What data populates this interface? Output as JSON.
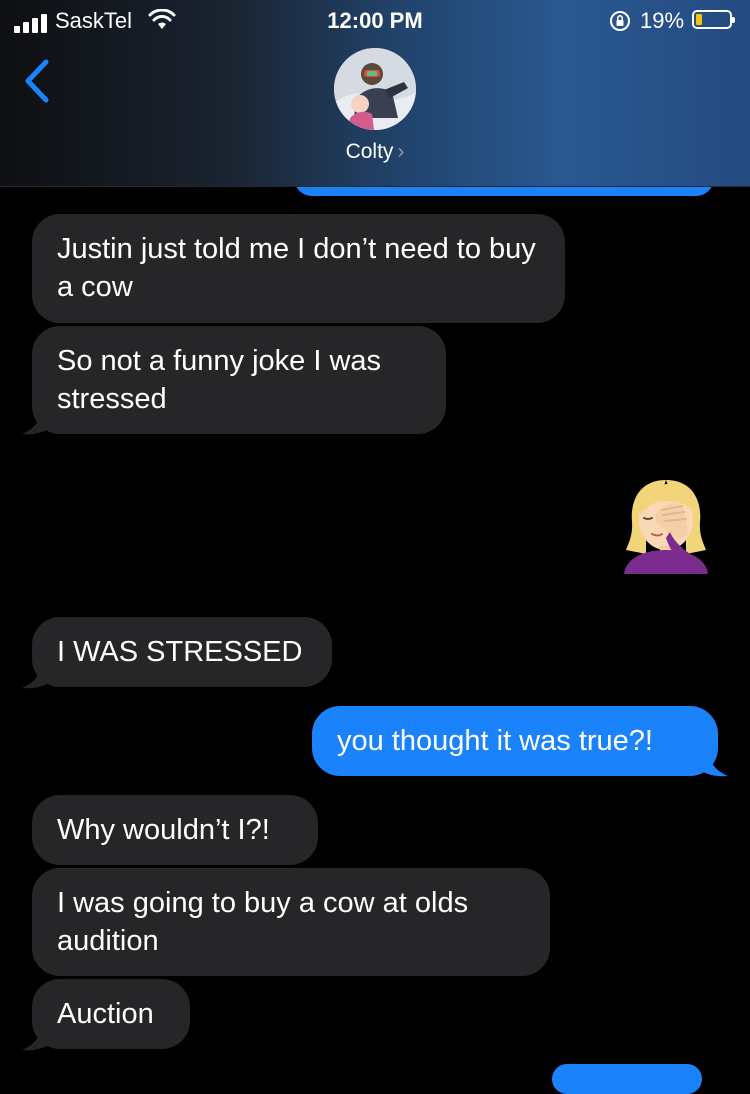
{
  "status_bar": {
    "carrier": "SaskTel",
    "time": "12:00 PM",
    "battery_percent": "19%",
    "battery_level": 0.19,
    "battery_color": "#f4c30b"
  },
  "header": {
    "back_icon": "chevron-left-icon",
    "contact_name": "Colty",
    "contact_chevron": "›",
    "accent": "#1a82fb"
  },
  "messages": [
    {
      "side": "received",
      "text": "Justin just told me I don’t need to buy a cow"
    },
    {
      "side": "received",
      "text": "So not a funny joke I was stressed"
    },
    {
      "side": "sent",
      "type": "emoji",
      "emoji_name": "woman-facepalming-icon"
    },
    {
      "side": "received",
      "text": "I WAS STRESSED"
    },
    {
      "side": "sent",
      "text": "you thought it was true?!"
    },
    {
      "side": "received",
      "text": "Why wouldn’t I?!"
    },
    {
      "side": "received",
      "text": "I was going to buy a cow at olds audition"
    },
    {
      "side": "received",
      "text": "Auction"
    }
  ],
  "colors": {
    "received_bubble": "#262629",
    "sent_bubble": "#1a82fb",
    "background": "#000000"
  }
}
